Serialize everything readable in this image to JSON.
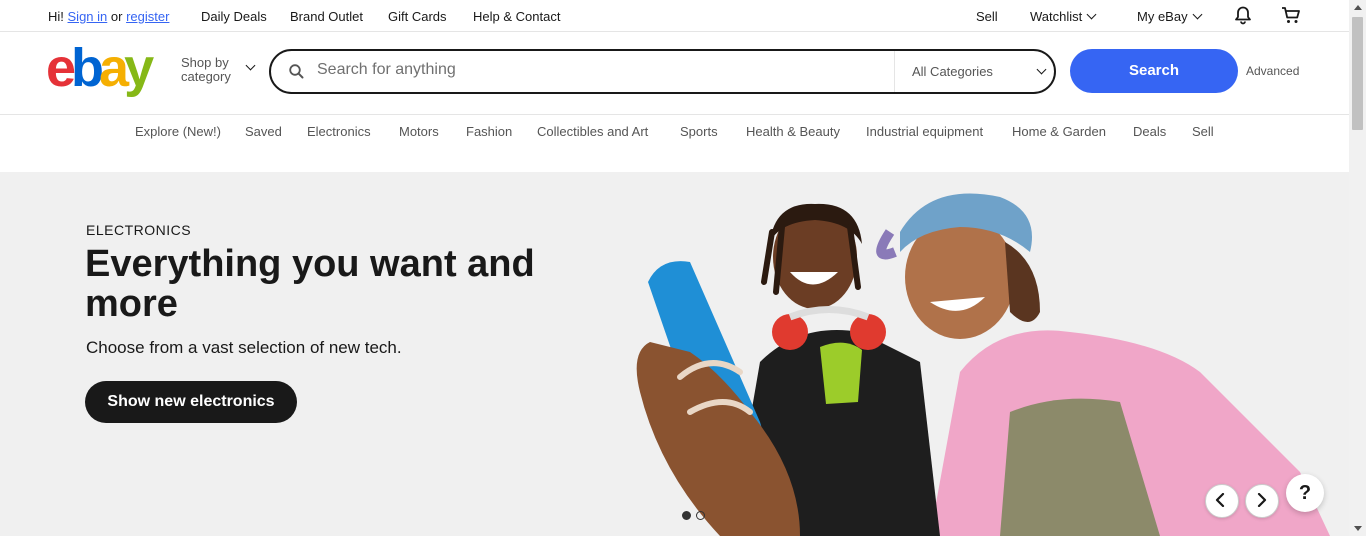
{
  "topbar": {
    "greeting": "Hi!",
    "sign_in": "Sign in",
    "or": "or",
    "register": "register",
    "links": [
      "Daily Deals",
      "Brand Outlet",
      "Gift Cards",
      "Help & Contact"
    ],
    "sell": "Sell",
    "watchlist": "Watchlist",
    "my_ebay": "My eBay",
    "icons": [
      "bell-icon",
      "cart-icon"
    ]
  },
  "header": {
    "logo_letters": [
      "e",
      "b",
      "a",
      "y"
    ],
    "logo_colors": [
      "#e53238",
      "#0064d2",
      "#f5af02",
      "#86b817"
    ],
    "shop_by_line1": "Shop by",
    "shop_by_line2": "category",
    "search_placeholder": "Search for anything",
    "category_select": "All Categories",
    "search_button": "Search",
    "advanced": "Advanced"
  },
  "nav": [
    "Explore (New!)",
    "Saved",
    "Electronics",
    "Motors",
    "Fashion",
    "Collectibles and Art",
    "Sports",
    "Health & Beauty",
    "Industrial equipment",
    "Home & Garden",
    "Deals",
    "Sell"
  ],
  "hero": {
    "eyebrow": "ELECTRONICS",
    "title": "Everything you want and more",
    "subtitle": "Choose from a vast selection of new tech.",
    "cta": "Show new electronics",
    "background": "#f0f0f0"
  },
  "help_button": "?",
  "colors": {
    "accent": "#3665f3",
    "text": "#191919"
  }
}
